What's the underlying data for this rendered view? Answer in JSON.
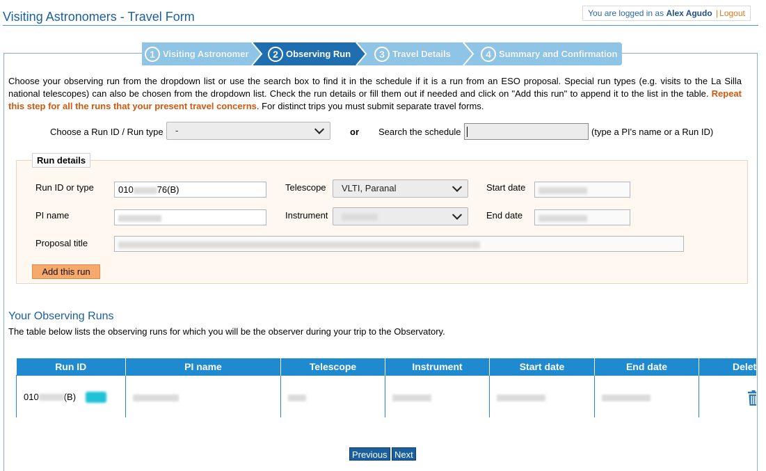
{
  "page": {
    "title": "Visiting Astronomers - Travel Form"
  },
  "login": {
    "prefix": "You are logged in as",
    "user": "Alex Agudo",
    "separator": "|",
    "logout": "Logout"
  },
  "steps": [
    {
      "num": "1",
      "label": "Visiting Astronomer",
      "active": false
    },
    {
      "num": "2",
      "label": "Observing Run",
      "active": true
    },
    {
      "num": "3",
      "label": "Travel Details",
      "active": false
    },
    {
      "num": "4",
      "label": "Summary and Confirmation",
      "active": false
    }
  ],
  "intro": {
    "text": "Choose your observing run from the dropdown list or use the search box to find it in the schedule if it is a run from an ESO proposal. Special run types (e.g. visits to the La Silla national telescopes) can also be chosen from the dropdown list. Check the run details or fill them out if needed and click on \"Add this run\" to append it to the list in the table. ",
    "warning": "Repeat this step for all the runs that your present travel concerns",
    "tail": ". For distinct trips you must submit separate travel forms."
  },
  "chooser": {
    "label": "Choose a Run ID / Run type",
    "selected": "-",
    "or": "or",
    "search_label": "Search the schedule",
    "search_value": "",
    "search_hint": "(type a PI's name or a Run ID)"
  },
  "run_details": {
    "legend": "Run details",
    "run_id_label": "Run ID or type",
    "run_id_prefix": "010",
    "run_id_suffix": "76(B)",
    "telescope_label": "Telescope",
    "telescope_value": "VLTI, Paranal",
    "start_label": "Start date",
    "pi_label": "PI name",
    "instrument_label": "Instrument",
    "end_label": "End date",
    "proposal_label": "Proposal title",
    "add_button": "Add this run"
  },
  "runs": {
    "heading": "Your Observing Runs",
    "description": "The table below lists the observing runs for which you will be the observer during your trip to the Observatory.",
    "columns": [
      "Run ID",
      "PI name",
      "Telescope",
      "Instrument",
      "Start date",
      "End date",
      "Delete"
    ],
    "rows": [
      {
        "run_id_prefix": "010",
        "run_id_suffix": "(B)"
      }
    ]
  },
  "nav": {
    "previous": "Previous",
    "next": "Next"
  },
  "colors": {
    "accent": "#1a5f9e",
    "step_active": "#1f6fb0",
    "step_inactive": "#8ec4e6",
    "table_header": "#1f8ad0",
    "warning": "#d0580f",
    "add_button": "#f7a86b"
  }
}
